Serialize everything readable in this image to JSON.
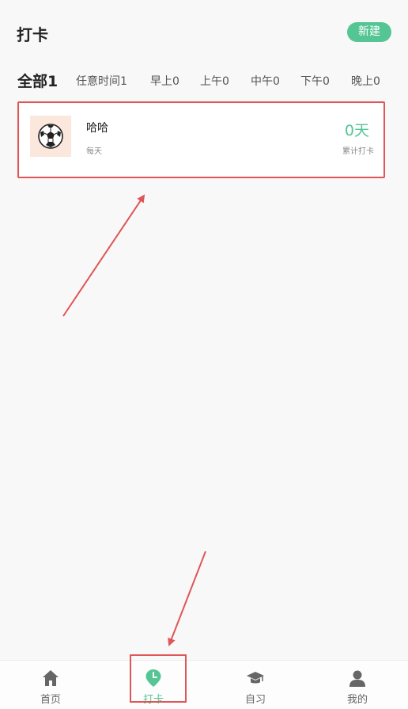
{
  "header": {
    "title": "打卡",
    "new_button": "新建"
  },
  "tabs": [
    {
      "label": "全部1",
      "active": true
    },
    {
      "label": "任意时间1",
      "active": false
    },
    {
      "label": "早上0",
      "active": false
    },
    {
      "label": "上午0",
      "active": false
    },
    {
      "label": "中午0",
      "active": false
    },
    {
      "label": "下午0",
      "active": false
    },
    {
      "label": "晚上0",
      "active": false
    }
  ],
  "habits": [
    {
      "name": "哈哈",
      "frequency": "每天",
      "days": "0天",
      "days_label": "累计打卡",
      "icon": "soccer-ball-icon"
    }
  ],
  "bottom_nav": [
    {
      "label": "首页",
      "icon": "home-icon",
      "active": false
    },
    {
      "label": "打卡",
      "icon": "clock-pin-icon",
      "active": true
    },
    {
      "label": "自习",
      "icon": "graduation-cap-icon",
      "active": false
    },
    {
      "label": "我的",
      "icon": "user-icon",
      "active": false
    }
  ],
  "colors": {
    "accent": "#55c594",
    "annotation": "#e05555",
    "thumb_bg": "#fbe7dc"
  }
}
